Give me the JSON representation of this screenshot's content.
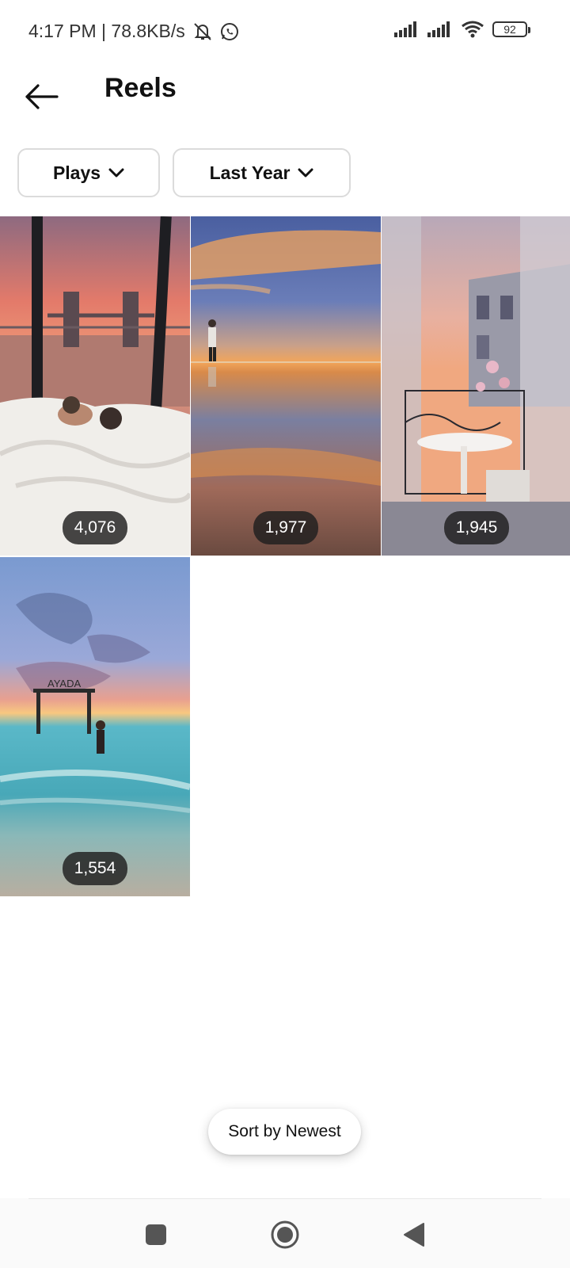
{
  "status_bar": {
    "time_speed": "4:17 PM | 78.8KB/s",
    "battery": "92",
    "icons": [
      "bell-off-icon",
      "whatsapp-icon",
      "signal-icon",
      "signal-icon",
      "wifi-icon",
      "battery-icon"
    ]
  },
  "header": {
    "title": "Reels",
    "back_icon": "arrow-left-icon"
  },
  "filters": {
    "metric": "Plays",
    "period": "Last Year",
    "chevron_icon": "chevron-down-icon"
  },
  "reels": [
    {
      "plays": "4,076",
      "scene": "london-bridge-bedroom"
    },
    {
      "plays": "1,977",
      "scene": "sunset-reflection-beach"
    },
    {
      "plays": "1,945",
      "scene": "paris-balcony"
    },
    {
      "plays": "1,554",
      "scene": "ayada-swing-sunset"
    }
  ],
  "sort": {
    "label": "Sort by Newest"
  },
  "navbar": {
    "icons": [
      "recents-square-icon",
      "home-circle-icon",
      "back-triangle-icon"
    ]
  },
  "colors": {
    "text": "#111111",
    "border": "#dbdbdb",
    "badge_bg": "#1e1e1e"
  }
}
